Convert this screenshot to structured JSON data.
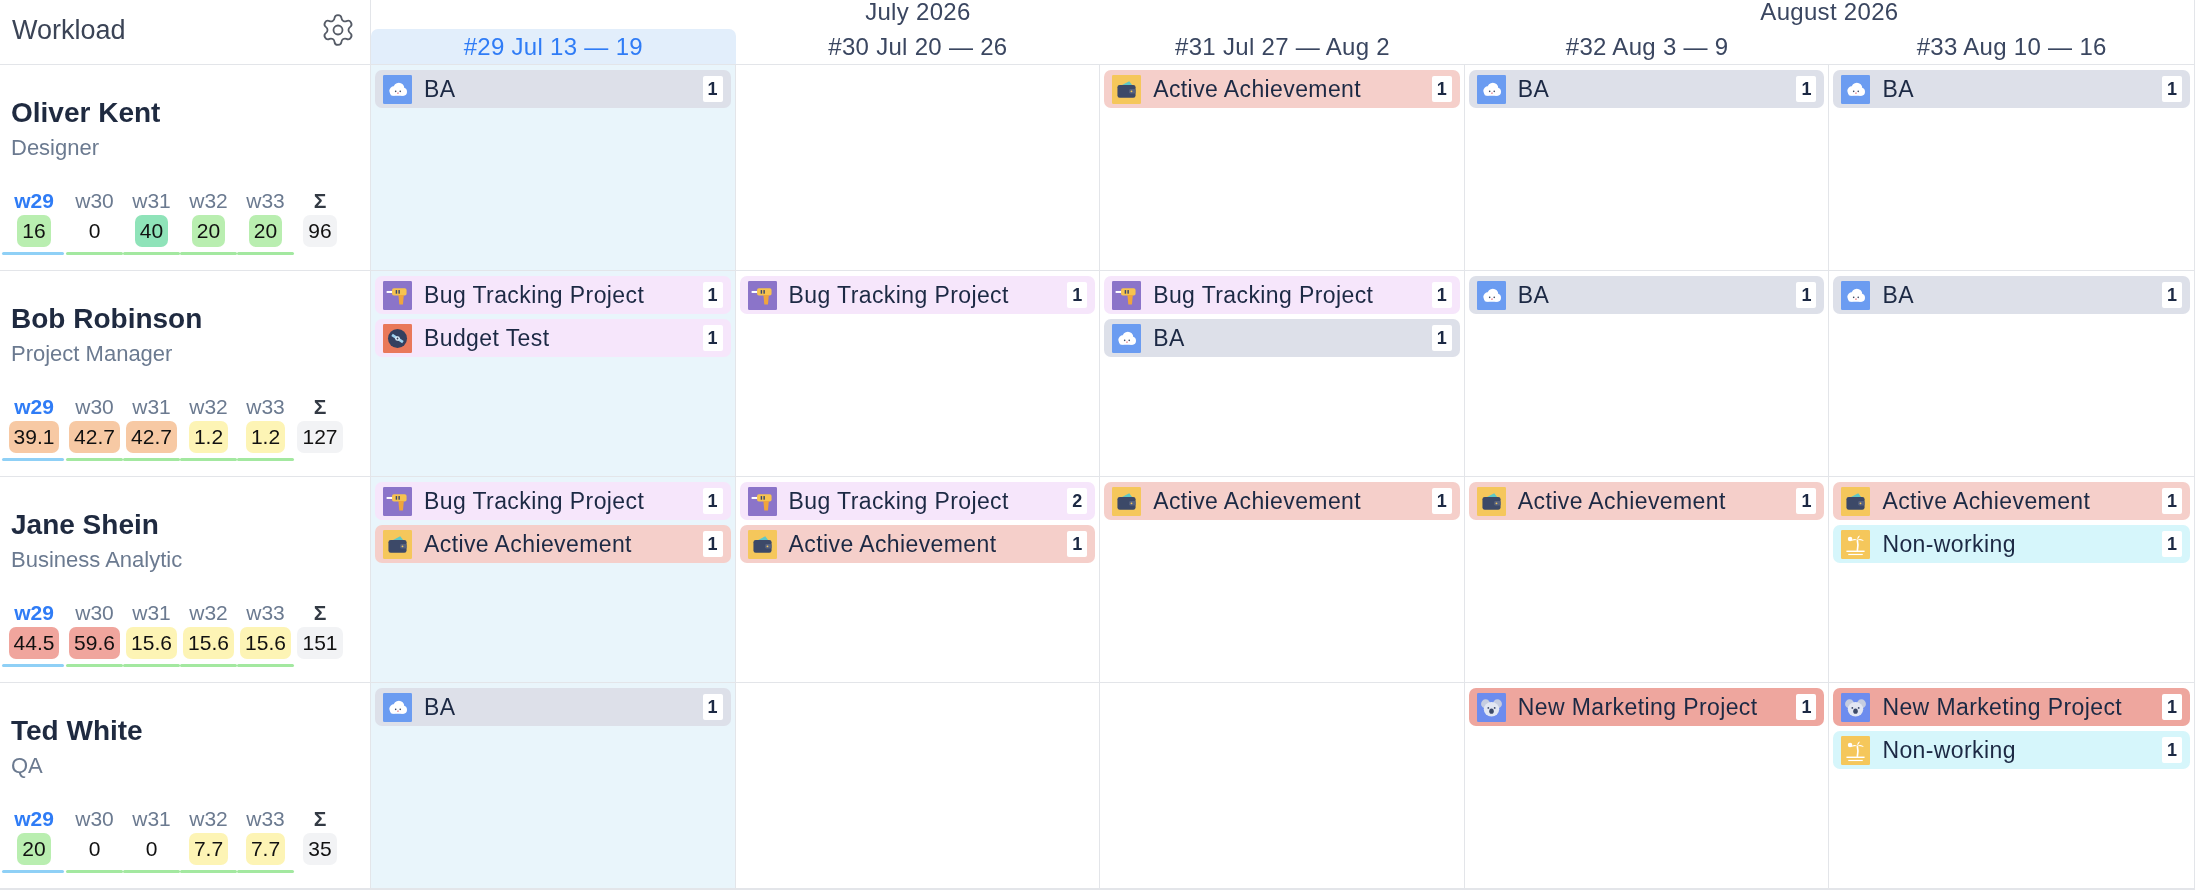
{
  "header": {
    "title": "Workload"
  },
  "months": [
    {
      "label": "July 2026",
      "weeks": [
        {
          "label": "#29 Jul 13 — 19",
          "selected": true
        },
        {
          "label": "#30 Jul 20 — 26",
          "selected": false
        },
        {
          "label": "#31 Jul 27 — Aug 2",
          "selected": false
        }
      ]
    },
    {
      "label": "August 2026",
      "weeks": [
        {
          "label": "#32 Aug 3 — 9",
          "selected": false
        },
        {
          "label": "#33 Aug 10 — 16",
          "selected": false
        }
      ]
    }
  ],
  "people": [
    {
      "name": "Oliver Kent",
      "role": "Designer",
      "weeks": [
        {
          "label": "w29",
          "value": "16",
          "color": "#b9eeb0",
          "selected": true,
          "tasks": [
            {
              "name": "BA",
              "count": "1",
              "kind": "cloud",
              "color": "#dde0e9"
            }
          ]
        },
        {
          "label": "w30",
          "value": "0",
          "selected": false
        },
        {
          "label": "w31",
          "value": "40",
          "color": "#8fe3b9",
          "selected": false,
          "tasks": [
            {
              "name": "Active Achievement",
              "count": "1",
              "kind": "wallet",
              "color": "#f5cfca"
            }
          ]
        },
        {
          "label": "w32",
          "value": "20",
          "color": "#b9eeb0",
          "selected": false,
          "tasks": [
            {
              "name": "BA",
              "count": "1",
              "kind": "cloud",
              "color": "#dde0e9"
            }
          ]
        },
        {
          "label": "w33",
          "value": "20",
          "color": "#b9eeb0",
          "selected": false,
          "tasks": [
            {
              "name": "BA",
              "count": "1",
              "kind": "cloud",
              "color": "#dde0e9"
            }
          ]
        }
      ],
      "total": {
        "label": "Σ",
        "value": "96"
      }
    },
    {
      "name": "Bob Robinson",
      "role": "Project Manager",
      "weeks": [
        {
          "label": "w29",
          "value": "39.1",
          "color": "#f7c9a4",
          "selected": true,
          "tasks": [
            {
              "name": "Bug Tracking Project",
              "count": "1",
              "kind": "drill",
              "color": "#f6e6fb"
            },
            {
              "name": "Budget Test",
              "count": "1",
              "kind": "disc",
              "color": "#f6e6fb"
            }
          ]
        },
        {
          "label": "w30",
          "value": "42.7",
          "color": "#f7c9a4",
          "selected": false,
          "tasks": [
            {
              "name": "Bug Tracking Project",
              "count": "1",
              "kind": "drill",
              "color": "#f6e6fb"
            }
          ]
        },
        {
          "label": "w31",
          "value": "42.7",
          "color": "#f7c9a4",
          "selected": false,
          "tasks": [
            {
              "name": "Bug Tracking Project",
              "count": "1",
              "kind": "drill",
              "color": "#f6e6fb"
            },
            {
              "name": "BA",
              "count": "1",
              "kind": "cloud",
              "color": "#dde0e9"
            }
          ]
        },
        {
          "label": "w32",
          "value": "1.2",
          "color": "#fdf4b5",
          "selected": false,
          "tasks": [
            {
              "name": "BA",
              "count": "1",
              "kind": "cloud",
              "color": "#dde0e9"
            }
          ]
        },
        {
          "label": "w33",
          "value": "1.2",
          "color": "#fdf4b5",
          "selected": false,
          "tasks": [
            {
              "name": "BA",
              "count": "1",
              "kind": "cloud",
              "color": "#dde0e9"
            }
          ]
        }
      ],
      "total": {
        "label": "Σ",
        "value": "127"
      }
    },
    {
      "name": "Jane Shein",
      "role": "Business Analytic",
      "weeks": [
        {
          "label": "w29",
          "value": "44.5",
          "color": "#f0a59d",
          "selected": true,
          "tasks": [
            {
              "name": "Bug Tracking Project",
              "count": "1",
              "kind": "drill",
              "color": "#f6e6fb"
            },
            {
              "name": "Active Achievement",
              "count": "1",
              "kind": "wallet",
              "color": "#f5cfca"
            }
          ]
        },
        {
          "label": "w30",
          "value": "59.6",
          "color": "#f0a59d",
          "selected": false,
          "tasks": [
            {
              "name": "Bug Tracking Project",
              "count": "2",
              "kind": "drill",
              "color": "#f6e6fb"
            },
            {
              "name": "Active Achievement",
              "count": "1",
              "kind": "wallet",
              "color": "#f5cfca"
            }
          ]
        },
        {
          "label": "w31",
          "value": "15.6",
          "color": "#fdf4b5",
          "selected": false,
          "tasks": [
            {
              "name": "Active Achievement",
              "count": "1",
              "kind": "wallet",
              "color": "#f5cfca"
            }
          ]
        },
        {
          "label": "w32",
          "value": "15.6",
          "color": "#fdf4b5",
          "selected": false,
          "tasks": [
            {
              "name": "Active Achievement",
              "count": "1",
              "kind": "wallet",
              "color": "#f5cfca"
            }
          ]
        },
        {
          "label": "w33",
          "value": "15.6",
          "color": "#fdf4b5",
          "selected": false,
          "tasks": [
            {
              "name": "Active Achievement",
              "count": "1",
              "kind": "wallet",
              "color": "#f5cfca"
            },
            {
              "name": "Non-working",
              "count": "1",
              "kind": "island",
              "color": "#d6f6fb"
            }
          ]
        }
      ],
      "total": {
        "label": "Σ",
        "value": "151"
      }
    },
    {
      "name": "Ted White",
      "role": "QA",
      "weeks": [
        {
          "label": "w29",
          "value": "20",
          "color": "#b9eeb0",
          "selected": true,
          "tasks": [
            {
              "name": "BA",
              "count": "1",
              "kind": "cloud",
              "color": "#dde0e9"
            }
          ]
        },
        {
          "label": "w30",
          "value": "0",
          "selected": false
        },
        {
          "label": "w31",
          "value": "0",
          "selected": false
        },
        {
          "label": "w32",
          "value": "7.7",
          "color": "#fdf4b5",
          "selected": false,
          "tasks": [
            {
              "name": "New Marketing Project",
              "count": "1",
              "kind": "koala",
              "color": "#eea69e"
            }
          ]
        },
        {
          "label": "w33",
          "value": "7.7",
          "color": "#fdf4b5",
          "selected": false,
          "tasks": [
            {
              "name": "New Marketing Project",
              "count": "1",
              "kind": "koala",
              "color": "#eea69e"
            },
            {
              "name": "Non-working",
              "count": "1",
              "kind": "island",
              "color": "#d6f6fb"
            }
          ]
        }
      ],
      "total": {
        "label": "Σ",
        "value": "35"
      }
    }
  ]
}
